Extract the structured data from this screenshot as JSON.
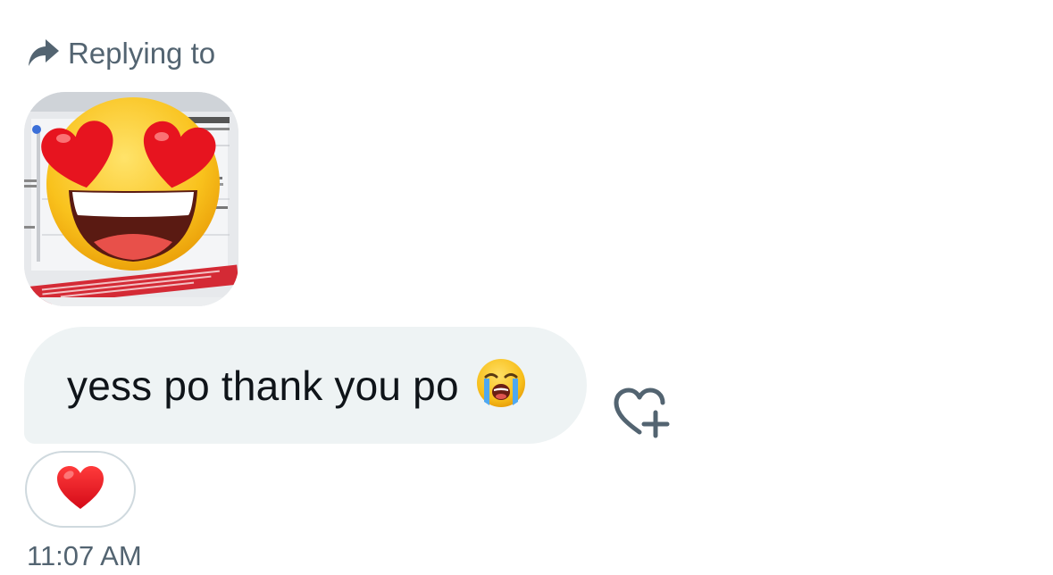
{
  "reply": {
    "label": "Replying to",
    "icon": "reply-arrow-icon",
    "thumbnail": {
      "icon": "heart-eyes-emoji-icon",
      "background": "voucher-ticket-photo"
    }
  },
  "message": {
    "text": "yess po thank you po",
    "emoji_icon": "loudly-crying-face-icon",
    "bubble_color": "#eef3f4"
  },
  "add_reaction": {
    "icon": "heart-plus-icon"
  },
  "reactions": [
    {
      "icon": "red-heart-icon"
    }
  ],
  "timestamp": "11:07 AM",
  "colors": {
    "muted_text": "#536471",
    "primary_text": "#0f1419",
    "pill_border": "#cfd9de",
    "heart": "#e8142a"
  }
}
